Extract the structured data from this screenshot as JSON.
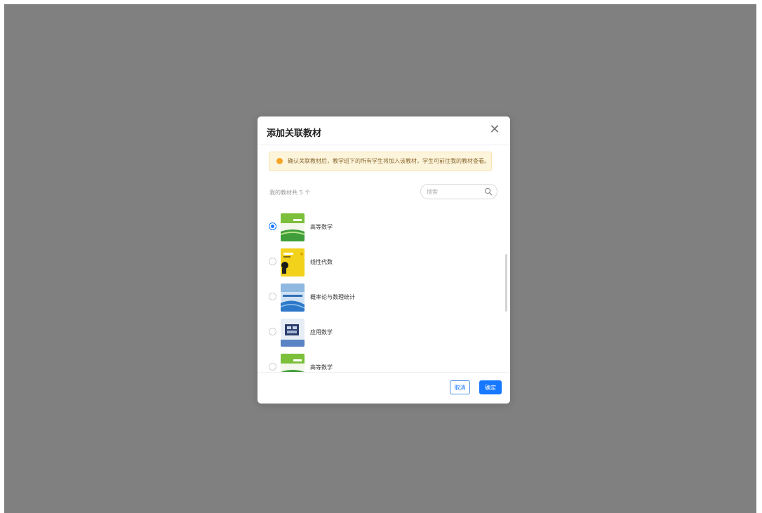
{
  "dialog": {
    "title": "添加关联教材",
    "close_symbol": "✕",
    "notice": "确认关联教材后，教学班下的所有学生将加入该教材，学生可前往我的教材查看。",
    "count_label": "我的教材共 5 个",
    "search": {
      "placeholder": "搜索",
      "value": ""
    },
    "items": [
      {
        "name": "高等数学",
        "selected": true,
        "cover_theme": "green"
      },
      {
        "name": "线性代数",
        "selected": false,
        "cover_theme": "yellow"
      },
      {
        "name": "概率论与数理统计",
        "selected": false,
        "cover_theme": "blue"
      },
      {
        "name": "应用数学",
        "selected": false,
        "cover_theme": "gray-blue"
      },
      {
        "name": "高等数学",
        "selected": false,
        "cover_theme": "green"
      }
    ],
    "buttons": {
      "cancel": "取消",
      "ok": "确定"
    }
  },
  "colors": {
    "overlay": "#808080",
    "primary": "#1677ff",
    "notice_bg": "#fdf4dc",
    "notice_icon": "#f5a623"
  }
}
